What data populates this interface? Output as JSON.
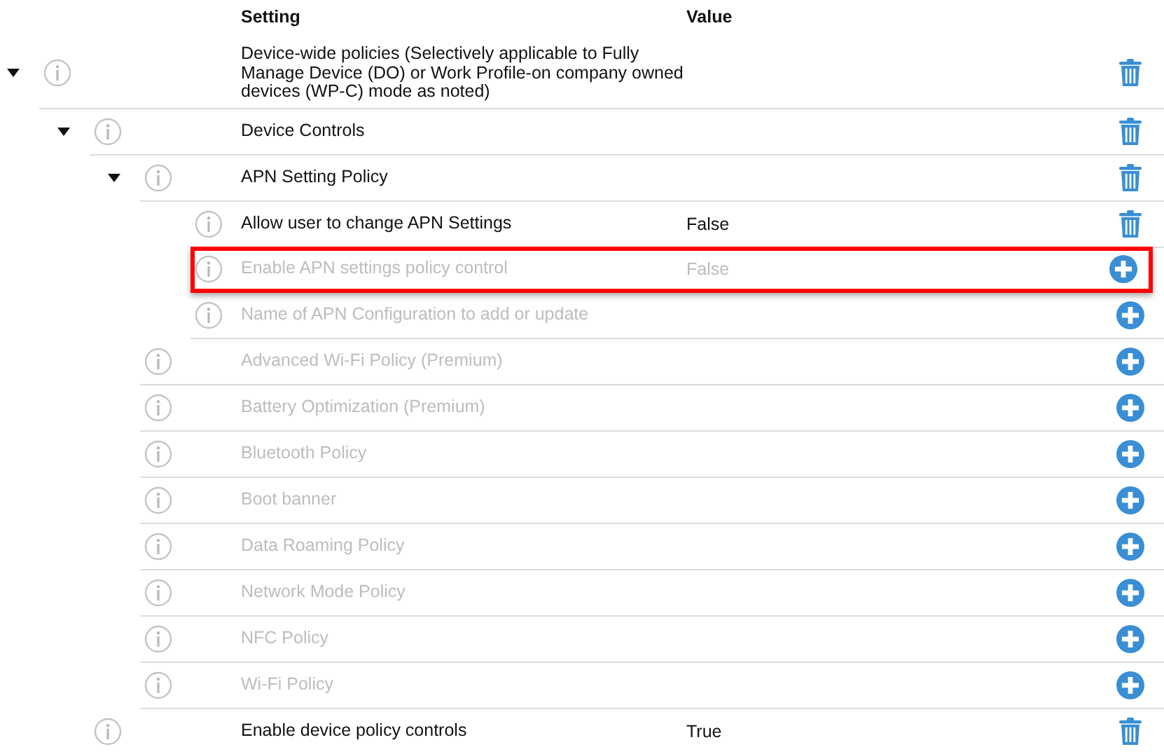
{
  "columns": {
    "setting": "Setting",
    "value": "Value"
  },
  "rows": [
    {
      "setting": "Device-wide policies (Selectively applicable to Fully Manage Device (DO) or Work Profile-on company owned devices (WP-C) mode as noted)",
      "configured": true,
      "highlighted": false,
      "expanded": true,
      "children": [
        {
          "setting": "Device Controls",
          "configured": true,
          "highlighted": false,
          "expanded": true,
          "children": [
            {
              "setting": "APN Setting Policy",
              "configured": true,
              "highlighted": false,
              "expanded": true,
              "children": [
                {
                  "setting": "Allow user to change APN Settings",
                  "value": "False",
                  "configured": true,
                  "highlighted": false
                },
                {
                  "setting": "Enable APN settings policy control",
                  "value": "False",
                  "configured": false,
                  "highlighted": true
                },
                {
                  "setting": "Name of APN Configuration to add or update",
                  "configured": false,
                  "highlighted": false
                }
              ]
            },
            {
              "setting": "Advanced Wi-Fi Policy (Premium)",
              "configured": false,
              "highlighted": false
            },
            {
              "setting": "Battery Optimization (Premium)",
              "configured": false,
              "highlighted": false
            },
            {
              "setting": "Bluetooth Policy",
              "configured": false,
              "highlighted": false
            },
            {
              "setting": "Boot banner",
              "configured": false,
              "highlighted": false
            },
            {
              "setting": "Data Roaming Policy",
              "configured": false,
              "highlighted": false
            },
            {
              "setting": "Network Mode Policy",
              "configured": false,
              "highlighted": false
            },
            {
              "setting": "NFC Policy",
              "configured": false,
              "highlighted": false
            },
            {
              "setting": "Wi-Fi Policy",
              "configured": false,
              "highlighted": false
            }
          ]
        },
        {
          "setting": "Enable device policy controls",
          "value": "True",
          "configured": true,
          "highlighted": false
        }
      ]
    }
  ]
}
